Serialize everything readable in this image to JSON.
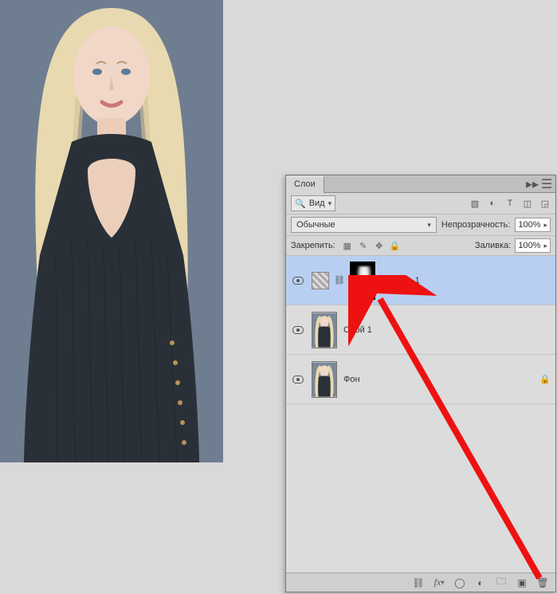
{
  "panel": {
    "tab_label": "Слои",
    "filter_label": "Вид"
  },
  "blend": {
    "mode": "Обычные",
    "opacity_label": "Непрозрачность:",
    "opacity_value": "100%"
  },
  "lock": {
    "label": "Закрепить:",
    "fill_label": "Заливка:",
    "fill_value": "100%"
  },
  "layers": {
    "curves": "Кривые 1",
    "layer1": "Слой 1",
    "background": "Фон"
  },
  "footer": {
    "fx_label": "fx"
  }
}
